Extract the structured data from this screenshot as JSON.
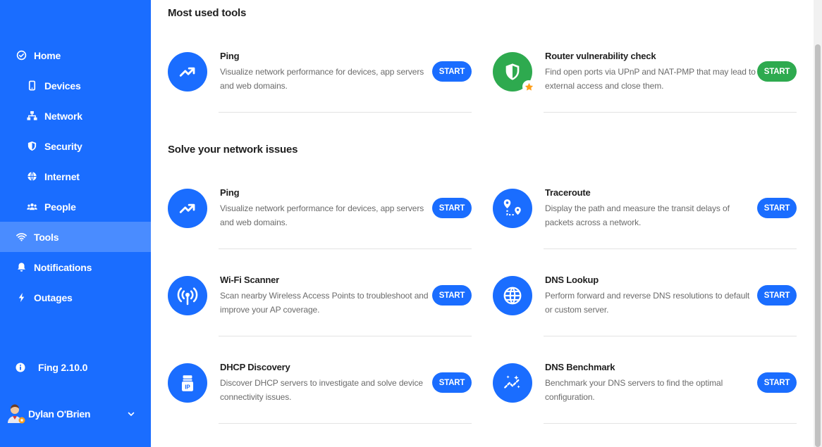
{
  "sidebar": {
    "items": [
      {
        "label": "Home",
        "icon": "check-circle-icon"
      },
      {
        "label": "Devices",
        "icon": "phone-icon"
      },
      {
        "label": "Network",
        "icon": "network-icon"
      },
      {
        "label": "Security",
        "icon": "shield-icon"
      },
      {
        "label": "Internet",
        "icon": "globe-icon"
      },
      {
        "label": "People",
        "icon": "people-icon"
      },
      {
        "label": "Tools",
        "icon": "wifi-icon"
      },
      {
        "label": "Notifications",
        "icon": "bell-icon"
      },
      {
        "label": "Outages",
        "icon": "bolt-icon"
      }
    ],
    "version": "Fing 2.10.0",
    "user": "Dylan O'Brien"
  },
  "sections": {
    "most_used": {
      "title": "Most used tools",
      "cards": [
        {
          "title": "Ping",
          "desc": "Visualize network performance for devices, app servers and web domains.",
          "button": "START",
          "icon": "trend-up-icon"
        },
        {
          "title": "Router vulnerability check",
          "desc": "Find open ports via UPnP and NAT-PMP that may lead to external access and close them.",
          "button": "START",
          "icon": "shield-check-icon"
        }
      ]
    },
    "solve": {
      "title": "Solve your network issues",
      "cards": [
        {
          "title": "Ping",
          "desc": "Visualize network performance for devices, app servers and web domains.",
          "button": "START",
          "icon": "trend-up-icon"
        },
        {
          "title": "Traceroute",
          "desc": "Display the path and measure the transit delays of packets across a network.",
          "button": "START",
          "icon": "route-icon"
        },
        {
          "title": "Wi-Fi Scanner",
          "desc": "Scan nearby Wireless Access Points to troubleshoot and improve your AP coverage.",
          "button": "START",
          "icon": "antenna-icon"
        },
        {
          "title": "DNS Lookup",
          "desc": "Perform forward and reverse DNS resolutions to default or custom server.",
          "button": "START",
          "icon": "globe-icon"
        },
        {
          "title": "DHCP Discovery",
          "desc": "Discover DHCP servers to investigate and solve device connectivity issues.",
          "button": "START",
          "icon": "ip-icon"
        },
        {
          "title": "DNS Benchmark",
          "desc": "Benchmark your DNS servers to find the optimal configuration.",
          "button": "START",
          "icon": "sparkle-trend-icon"
        }
      ]
    }
  },
  "colors": {
    "primary": "#1a6dff",
    "green": "#2eaa4f",
    "active_nav": "#4a8cff"
  }
}
